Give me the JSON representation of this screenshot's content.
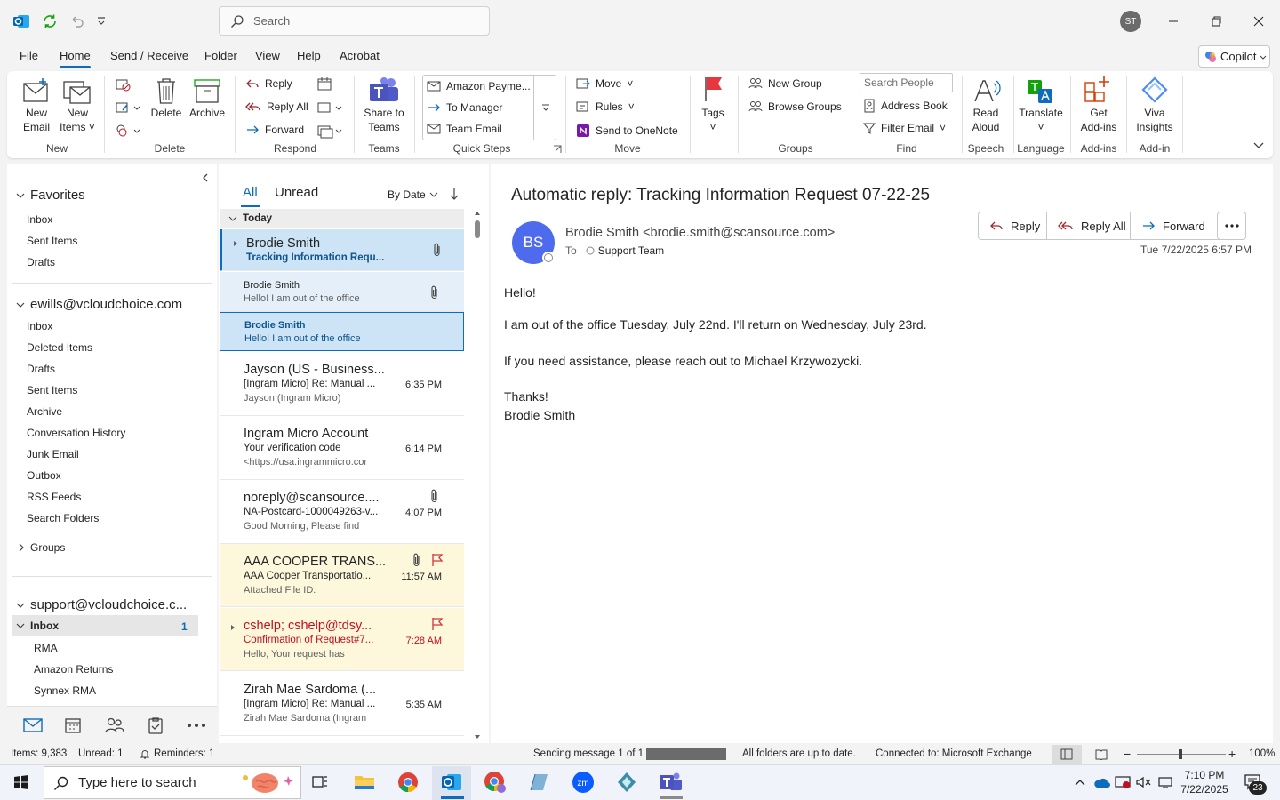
{
  "titlebar": {
    "search_placeholder": "Search",
    "user_initials": "ST"
  },
  "menu": {
    "items": [
      "File",
      "Home",
      "Send / Receive",
      "Folder",
      "View",
      "Help",
      "Acrobat"
    ],
    "active": "Home",
    "copilot_label": "Copilot"
  },
  "ribbon": {
    "new": {
      "new_email": [
        "New",
        "Email"
      ],
      "new_items": [
        "New",
        "Items"
      ],
      "group": "New"
    },
    "delete": {
      "delete": "Delete",
      "archive": "Archive",
      "group": "Delete"
    },
    "respond": {
      "reply": "Reply",
      "reply_all": "Reply All",
      "forward": "Forward",
      "group": "Respond"
    },
    "teams": {
      "share": [
        "Share to",
        "Teams"
      ],
      "group": "Teams"
    },
    "quick_steps": {
      "items": [
        "Amazon Payme...",
        "To Manager",
        "Team Email"
      ],
      "group": "Quick Steps"
    },
    "move": {
      "move": "Move",
      "rules": "Rules",
      "onenote": "Send to OneNote",
      "group": "Move"
    },
    "tags": {
      "label": "Tags"
    },
    "groups": {
      "new_group": "New Group",
      "browse_groups": "Browse Groups",
      "group": "Groups"
    },
    "find": {
      "search_people": "Search People",
      "address_book": "Address Book",
      "filter_email": "Filter Email",
      "group": "Find"
    },
    "speech": {
      "read_aloud": [
        "Read",
        "Aloud"
      ],
      "group": "Speech"
    },
    "language": {
      "translate": "Translate",
      "group": "Language"
    },
    "addins": {
      "get": [
        "Get",
        "Add-ins"
      ],
      "group": "Add-ins"
    },
    "addin": {
      "viva": [
        "Viva",
        "Insights"
      ],
      "group": "Add-in"
    }
  },
  "folders": {
    "favorites_header": "Favorites",
    "favorites": [
      "Inbox",
      "Sent Items",
      "Drafts"
    ],
    "account1_header": "ewills@vcloudchoice.com",
    "account1": [
      "Inbox",
      "Deleted Items",
      "Drafts",
      "Sent Items",
      "Archive",
      "Conversation History",
      "Junk Email",
      "Outbox",
      "RSS Feeds",
      "Search Folders"
    ],
    "groups_label": "Groups",
    "account2_header": "support@vcloudchoice.c...",
    "inbox_label": "Inbox",
    "inbox_count": "1",
    "subfolders": [
      "RMA",
      "Amazon Returns",
      "Synnex RMA"
    ]
  },
  "list": {
    "tab_all": "All",
    "tab_unread": "Unread",
    "sort": "By Date",
    "section_today": "Today",
    "messages": [
      {
        "from": "Brodie Smith",
        "subject": "Tracking Information Requ...",
        "preview": "",
        "time": ""
      },
      {
        "from": "Brodie Smith",
        "subject": "Hello!  I am out of the office",
        "preview": "",
        "time": ""
      },
      {
        "from": "Brodie Smith",
        "subject": "Hello!  I am out of the office",
        "preview": "",
        "time": ""
      },
      {
        "from": "Jayson (US - Business...",
        "subject": "[Ingram Micro] Re: Manual ...",
        "preview": "Jayson (Ingram Micro)",
        "time": "6:35 PM"
      },
      {
        "from": "Ingram Micro Account",
        "subject": "Your verification code",
        "preview": "<https://usa.ingrammicro.cor",
        "time": "6:14 PM"
      },
      {
        "from": "noreply@scansource....",
        "subject": "NA-Postcard-1000049263-v...",
        "preview": "Good Morning, Please find",
        "time": "4:07 PM"
      },
      {
        "from": "AAA COOPER TRANS...",
        "subject": "AAA Cooper Transportatio...",
        "preview": "Attached File ID:",
        "time": "11:57 AM"
      },
      {
        "from": "cshelp;  cshelp@tdsy...",
        "subject": "Confirmation of Request#7...",
        "preview": "Hello,  Your request has",
        "time": "7:28 AM"
      },
      {
        "from": "Zirah Mae Sardoma (...",
        "subject": "[Ingram Micro] Re: Manual ...",
        "preview": "Zirah Mae Sardoma (Ingram",
        "time": "5:35 AM"
      }
    ]
  },
  "reading": {
    "subject": "Automatic reply: Tracking Information Request   07-22-25",
    "sender_initials": "BS",
    "sender": "Brodie Smith <brodie.smith@scansource.com>",
    "to_label": "To",
    "to": "Support Team",
    "datetime": "Tue 7/22/2025 6:57 PM",
    "btn_reply": "Reply",
    "btn_reply_all": "Reply All",
    "btn_forward": "Forward",
    "body": [
      "Hello!",
      "I am out of the office Tuesday, July 22nd. I'll return on Wednesday, July 23rd.",
      "If you need assistance,  please reach out to Michael Krzywozycki.",
      "Thanks!",
      "Brodie Smith"
    ]
  },
  "status": {
    "items": "Items: 9,383",
    "unread": "Unread: 1",
    "reminders": "Reminders: 1",
    "sending": "Sending message 1 of 1",
    "folders": "All folders are up to date.",
    "connected": "Connected to: Microsoft Exchange",
    "zoom": "100%"
  },
  "taskbar": {
    "search_placeholder": "Type here to search",
    "time": "7:10 PM",
    "date": "7/22/2025",
    "notifications": "23"
  },
  "colors": {
    "accent": "#0f6cbd",
    "avatar_bs": "#4f6bed",
    "flag": "#d13438",
    "selected": "#cce4f6"
  }
}
